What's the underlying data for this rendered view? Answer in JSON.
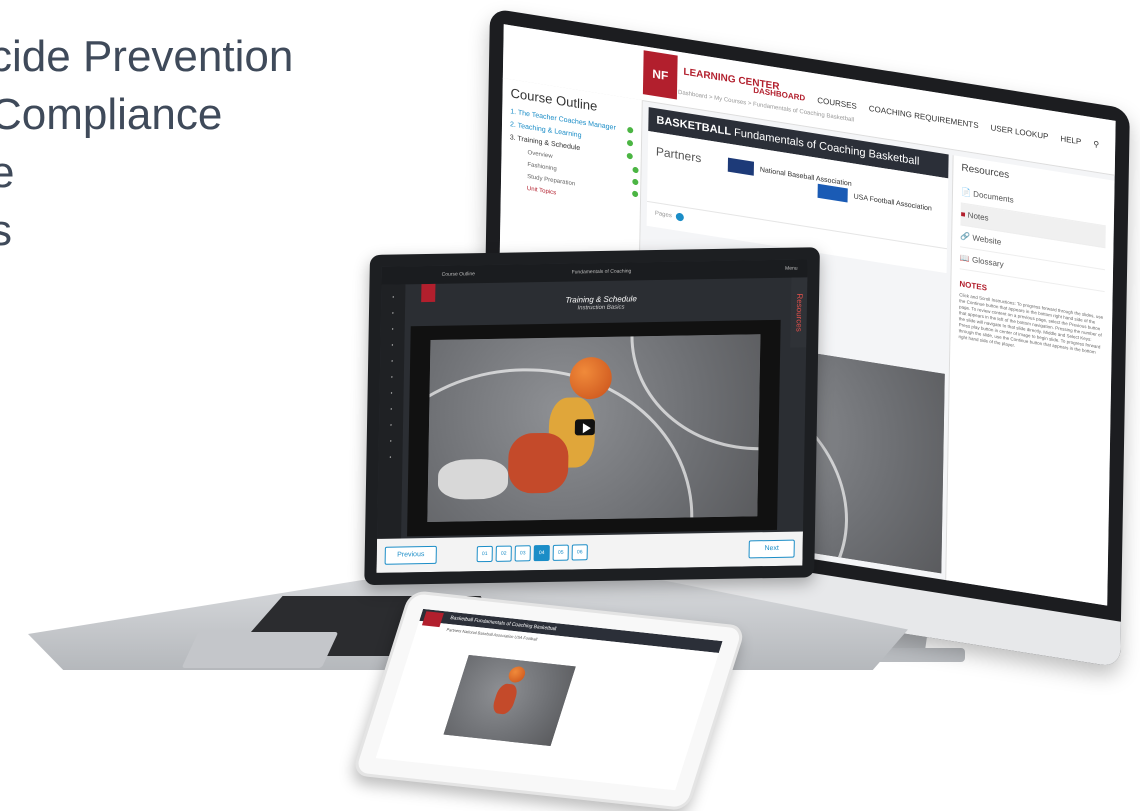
{
  "headline": {
    "lines": [
      "cide Prevention",
      "Compliance",
      "e",
      "s"
    ]
  },
  "desktop": {
    "logo": {
      "text": "NF HS",
      "subtitle": "LEARNING CENTER"
    },
    "nav": [
      "DASHBOARD",
      "COURSES",
      "COACHING REQUIREMENTS",
      "USER LOOKUP",
      "HELP"
    ],
    "breadcrumb": "Dashboard > My Courses > Fundamentals of Coaching Basketball",
    "outline": {
      "title": "Course Outline",
      "items": [
        {
          "label": "1.  The Teacher Coaches Manager"
        },
        {
          "label": "2.  Teaching & Learning"
        },
        {
          "label": "3.  Training & Schedule"
        }
      ],
      "subitems": [
        "Overview",
        "Fashioning",
        "Study Preparation",
        "Unit Topics"
      ]
    },
    "banner": {
      "bold": "BASKETBALL",
      "rest": " Fundamentals of Coaching Basketball"
    },
    "partners": {
      "label": "Partners",
      "p1": "National Baseball Association",
      "p2": "USA Football Association"
    },
    "pages_label": "Pages",
    "resources": {
      "title": "Resources",
      "items": [
        "Documents",
        "Notes",
        "Website",
        "Glossary"
      ],
      "notes_title": "NOTES",
      "notes_body": "Click and Scroll Instructions: To progress forward through the slides, use the Continue button that appears in the bottom right hand side of the page. To review content on a previous page, select the Previous button that appears in the left of the bottom navigation. Pressing the number of the slide will navigate to that slide directly. Middle and Select Keys: Press play button in center of image to begin slide. To progress forward through the slide, use the Continue button that appears in the bottom right hand side of the player."
    }
  },
  "laptop": {
    "course_label": "Course Outline",
    "page_label": "Fundamentals of Coaching",
    "menu_label": "Menu",
    "resources_tab": "Resources",
    "title": "Training & Schedule",
    "subtitle": "Instruction Basics",
    "prev": "Previous",
    "next": "Next",
    "pages": [
      "01",
      "02",
      "03",
      "04",
      "05",
      "06"
    ],
    "current_page": "04"
  },
  "tablet": {
    "bar": "Basketball Fundamentals of Coaching Basketball",
    "partners": "Partners  National Baseball Association  USA Football"
  },
  "colors": {
    "brand_red": "#b21f2d",
    "accent_blue": "#1b8dc7",
    "text_gray": "#3f4a5a"
  }
}
